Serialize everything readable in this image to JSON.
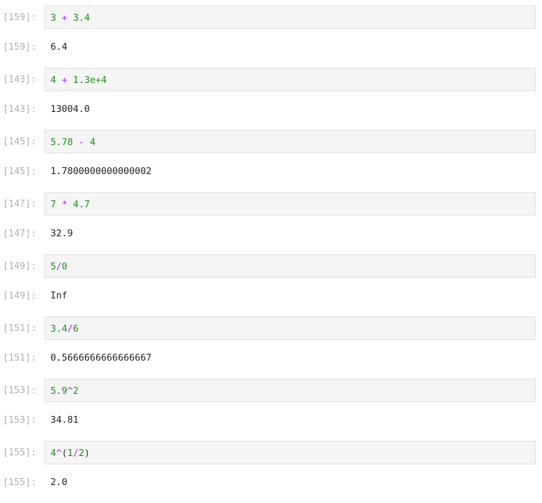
{
  "colors": {
    "number": "#228b22",
    "operator": "#aa22ff",
    "prompt": "#b0b0b0",
    "input_background": "#f5f5f5"
  },
  "cells": [
    {
      "in_prompt": "[159]:",
      "out_prompt": "[159]:",
      "tokens": [
        {
          "type": "num",
          "text": "3"
        },
        {
          "type": "plain",
          "text": " "
        },
        {
          "type": "op",
          "text": "+"
        },
        {
          "type": "plain",
          "text": " "
        },
        {
          "type": "num",
          "text": "3.4"
        }
      ],
      "output": "6.4"
    },
    {
      "in_prompt": "[143]:",
      "out_prompt": "[143]:",
      "tokens": [
        {
          "type": "num",
          "text": "4"
        },
        {
          "type": "plain",
          "text": " "
        },
        {
          "type": "op",
          "text": "+"
        },
        {
          "type": "plain",
          "text": " "
        },
        {
          "type": "num",
          "text": "1.3e+4"
        }
      ],
      "output": "13004.0"
    },
    {
      "in_prompt": "[145]:",
      "out_prompt": "[145]:",
      "tokens": [
        {
          "type": "num",
          "text": "5.78"
        },
        {
          "type": "plain",
          "text": " "
        },
        {
          "type": "op",
          "text": "-"
        },
        {
          "type": "plain",
          "text": " "
        },
        {
          "type": "num",
          "text": "4"
        }
      ],
      "output": "1.7800000000000002"
    },
    {
      "in_prompt": "[147]:",
      "out_prompt": "[147]:",
      "tokens": [
        {
          "type": "num",
          "text": "7"
        },
        {
          "type": "plain",
          "text": " "
        },
        {
          "type": "op",
          "text": "*"
        },
        {
          "type": "plain",
          "text": " "
        },
        {
          "type": "num",
          "text": "4.7"
        }
      ],
      "output": "32.9"
    },
    {
      "in_prompt": "[149]:",
      "out_prompt": "[149]:",
      "tokens": [
        {
          "type": "num",
          "text": "5"
        },
        {
          "type": "op",
          "text": "/"
        },
        {
          "type": "num",
          "text": "0"
        }
      ],
      "output": "Inf"
    },
    {
      "in_prompt": "[151]:",
      "out_prompt": "[151]:",
      "tokens": [
        {
          "type": "num",
          "text": "3.4"
        },
        {
          "type": "op",
          "text": "/"
        },
        {
          "type": "num",
          "text": "6"
        }
      ],
      "output": "0.5666666666666667"
    },
    {
      "in_prompt": "[153]:",
      "out_prompt": "[153]:",
      "tokens": [
        {
          "type": "num",
          "text": "5.9"
        },
        {
          "type": "op",
          "text": "^"
        },
        {
          "type": "num",
          "text": "2"
        }
      ],
      "output": "34.81"
    },
    {
      "in_prompt": "[155]:",
      "out_prompt": "[155]:",
      "tokens": [
        {
          "type": "num",
          "text": "4"
        },
        {
          "type": "op",
          "text": "^"
        },
        {
          "type": "paren",
          "text": "("
        },
        {
          "type": "num",
          "text": "1"
        },
        {
          "type": "op",
          "text": "/"
        },
        {
          "type": "num",
          "text": "2"
        },
        {
          "type": "paren",
          "text": ")"
        }
      ],
      "output": "2.0"
    }
  ]
}
